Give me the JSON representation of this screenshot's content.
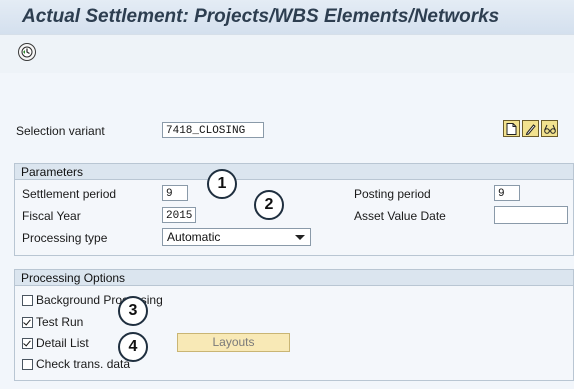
{
  "window": {
    "title": "Actual Settlement: Projects/WBS Elements/Networks"
  },
  "toolbar": {
    "execute_icon": "execute-clock-icon"
  },
  "selection_variant": {
    "label": "Selection variant",
    "value": "7418_CLOSING",
    "icons": [
      "new-document-icon",
      "edit-pencil-icon",
      "glasses-display-icon"
    ]
  },
  "parameters": {
    "title": "Parameters",
    "settlement_period_label": "Settlement period",
    "settlement_period_value": "9",
    "fiscal_year_label": "Fiscal Year",
    "fiscal_year_value": "2015",
    "processing_type_label": "Processing type",
    "processing_type_value": "Automatic",
    "posting_period_label": "Posting period",
    "posting_period_value": "9",
    "asset_value_date_label": "Asset Value Date",
    "asset_value_date_value": ""
  },
  "processing_options": {
    "title": "Processing Options",
    "background_processing": {
      "label": "Background Processing",
      "checked": false
    },
    "test_run": {
      "label": "Test Run",
      "checked": true
    },
    "detail_list": {
      "label": "Detail List",
      "checked": true
    },
    "check_trans": {
      "label": "Check trans. data",
      "checked": false
    },
    "layouts_label": "Layouts"
  },
  "callouts": [
    "1",
    "2",
    "3",
    "4"
  ]
}
